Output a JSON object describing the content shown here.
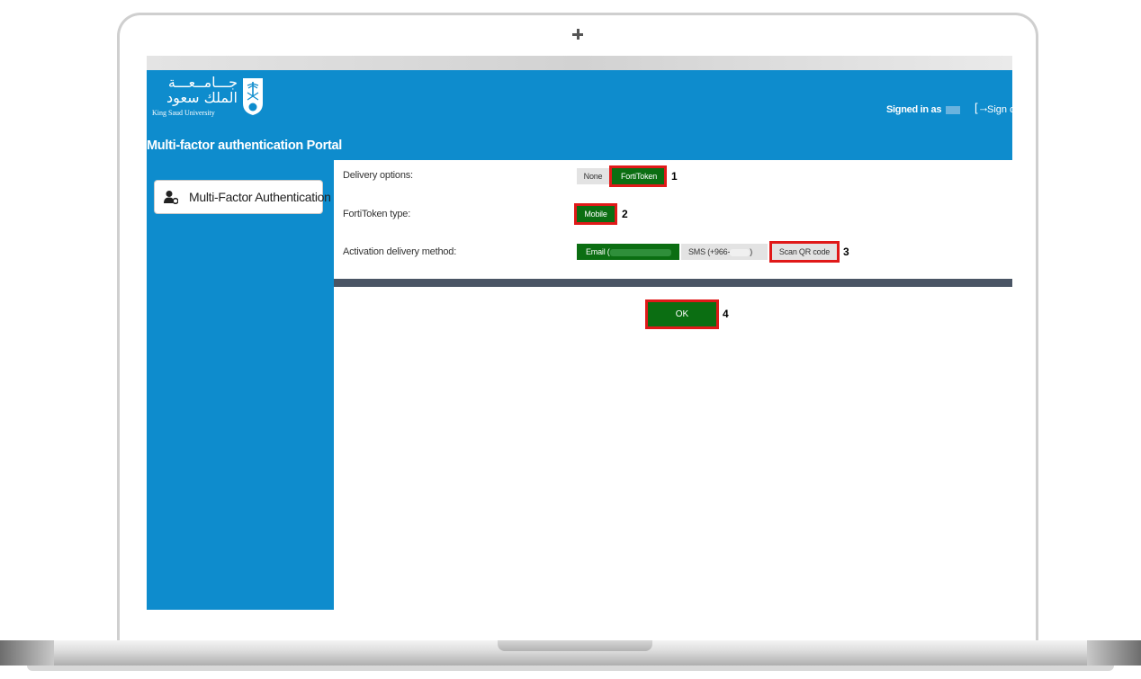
{
  "header": {
    "logo_arabic_line1": "جـــامــعـــة",
    "logo_arabic_line2": "الملك سعود",
    "logo_english": "King Saud University",
    "portal_title": "Multi-factor authentication Portal",
    "signed_in_label": "Signed in as",
    "sign_out_label": "Sign o"
  },
  "sidebar": {
    "items": [
      {
        "label": "Multi-Factor Authentication",
        "icon": "user-cog-icon"
      }
    ]
  },
  "form": {
    "delivery_options": {
      "label": "Delivery options:",
      "options": [
        "None",
        "FortiToken"
      ],
      "selected": "FortiToken",
      "annotation": "1"
    },
    "token_type": {
      "label": "FortiToken type:",
      "options": [
        "Mobile"
      ],
      "selected": "Mobile",
      "annotation": "2"
    },
    "activation_method": {
      "label": "Activation delivery method:",
      "email_label": "Email (",
      "sms_label": "SMS (+966-",
      "sms_suffix": ")",
      "scan_label": "Scan QR code",
      "annotation": "3"
    }
  },
  "ok_button": {
    "label": "OK",
    "annotation": "4"
  },
  "colors": {
    "header_blue": "#0e8ccd",
    "selected_green": "#0b6e12",
    "highlight_red": "#e01919",
    "divider": "#4a5565"
  }
}
